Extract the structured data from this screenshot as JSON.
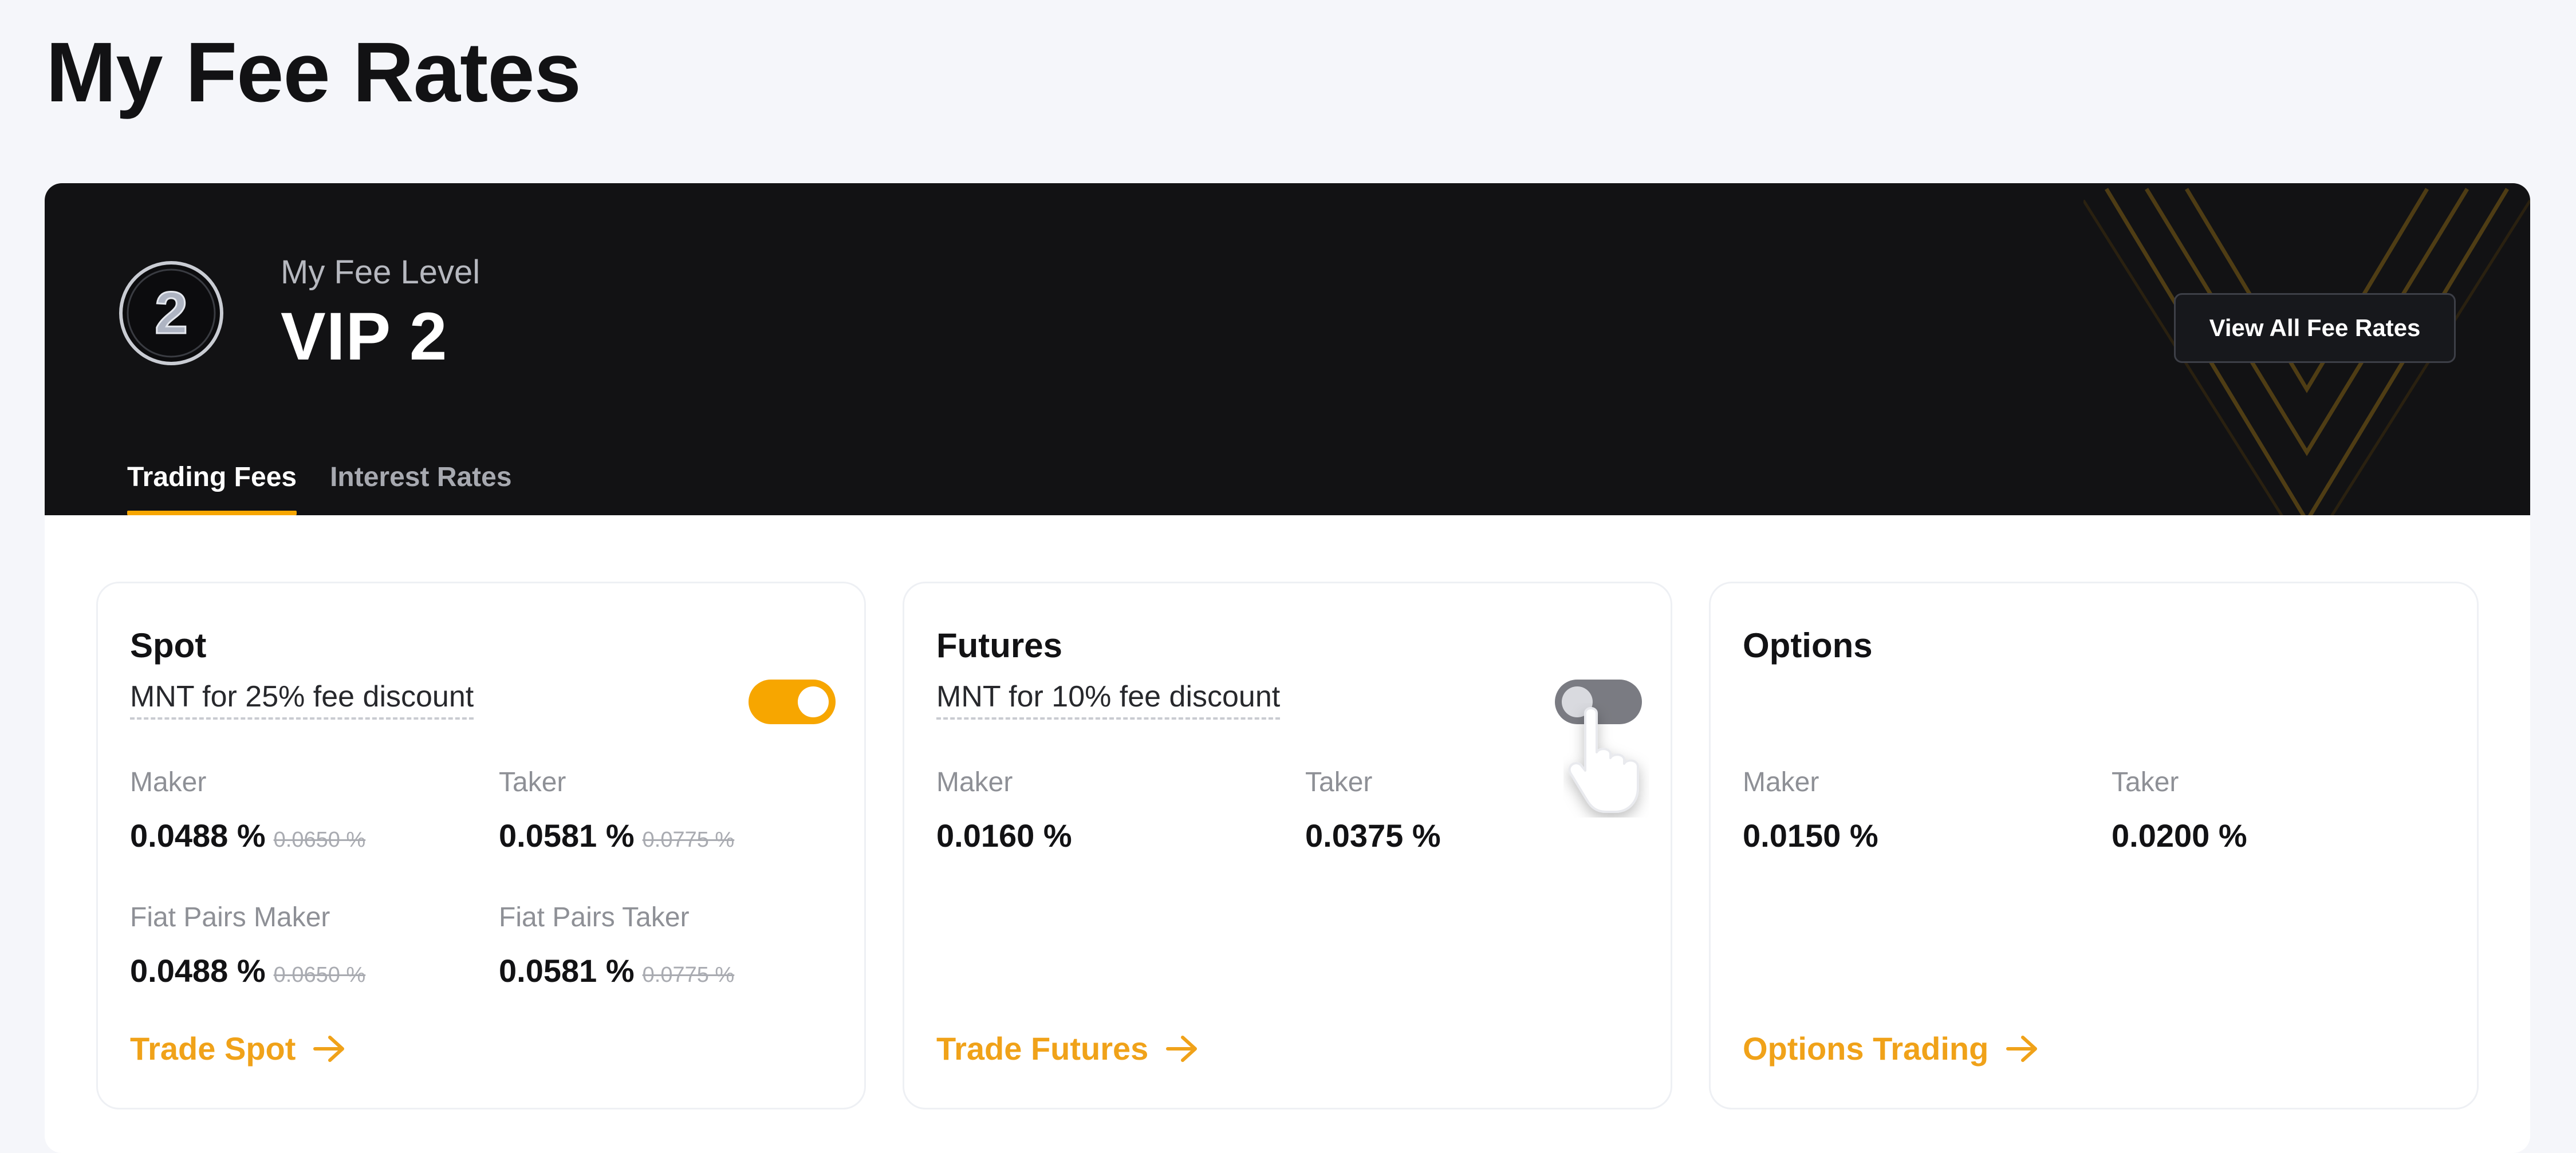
{
  "page": {
    "title": "My Fee Rates"
  },
  "banner": {
    "fee_level_label": "My Fee Level",
    "fee_level_value": "VIP 2",
    "badge_number": "2",
    "view_all_label": "View All Fee Rates",
    "tabs": [
      {
        "label": "Trading Fees",
        "active": true
      },
      {
        "label": "Interest Rates",
        "active": false
      }
    ]
  },
  "cards": [
    {
      "title": "Spot",
      "discount_label": "MNT for 25% fee discount",
      "discount_enabled": true,
      "maker_label": "Maker",
      "maker_value": "0.0488 %",
      "maker_old": "0.0650 %",
      "taker_label": "Taker",
      "taker_value": "0.0581 %",
      "taker_old": "0.0775 %",
      "fiat_maker_label": "Fiat Pairs Maker",
      "fiat_maker_value": "0.0488 %",
      "fiat_maker_old": "0.0650 %",
      "fiat_taker_label": "Fiat Pairs Taker",
      "fiat_taker_value": "0.0581 %",
      "fiat_taker_old": "0.0775 %",
      "link": "Trade Spot"
    },
    {
      "title": "Futures",
      "discount_label": "MNT for 10% fee discount",
      "discount_enabled": false,
      "maker_label": "Maker",
      "maker_value": "0.0160 %",
      "taker_label": "Taker",
      "taker_value": "0.0375 %",
      "link": "Trade Futures"
    },
    {
      "title": "Options",
      "maker_label": "Maker",
      "maker_value": "0.0150 %",
      "taker_label": "Taker",
      "taker_value": "0.0200 %",
      "link": "Options Trading"
    }
  ],
  "colors": {
    "accent": "#f7a600",
    "banner_bg": "#121214",
    "link": "#f0a219"
  },
  "icons": [
    "vip-level-badge-icon",
    "arrow-right-icon",
    "pointer-cursor-icon"
  ]
}
